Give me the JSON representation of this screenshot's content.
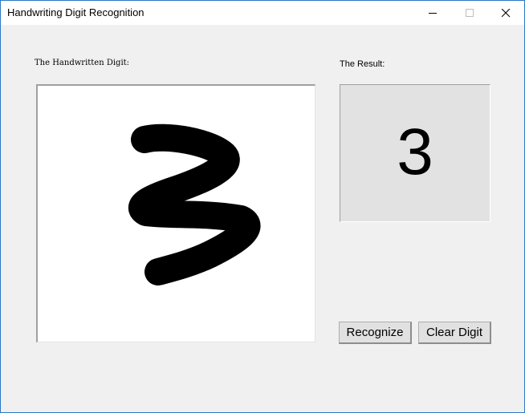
{
  "window": {
    "title": "Handwriting Digit Recognition",
    "controls": {
      "minimize_icon": "minimize-icon",
      "maximize_icon": "maximize-icon",
      "close_icon": "close-icon"
    }
  },
  "main": {
    "digit_label": "The Handwritten Digit:",
    "result_label": "The Result:",
    "result_value": "3",
    "canvas_drawing": "handwritten 3 stroke"
  },
  "buttons": {
    "recognize_label": "Recognize",
    "clear_label": "Clear Digit"
  },
  "colors": {
    "window_border": "#2b79c7",
    "background": "#f0f0f0",
    "canvas_bg": "#ffffff",
    "result_bg": "#e2e2e2",
    "stroke": "#000000"
  }
}
